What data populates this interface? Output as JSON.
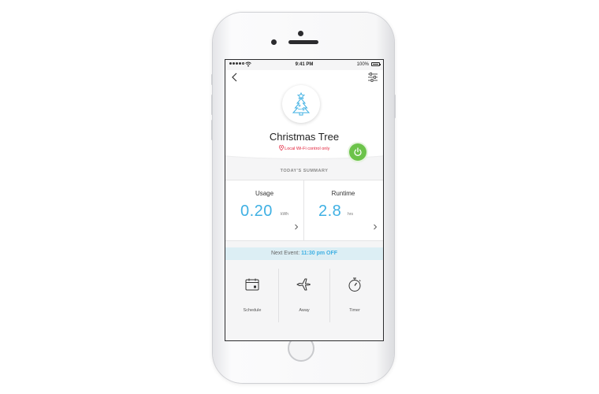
{
  "status_bar": {
    "time": "9:41 PM",
    "battery": "100%"
  },
  "nav": {
    "back_icon": "chevron-left-icon",
    "settings_icon": "sliders-icon"
  },
  "device": {
    "name": "Christmas Tree",
    "icon": "christmas-tree-icon",
    "note": "Local Wi-Fi control only",
    "power_on": true,
    "power_color": "#6cc34a"
  },
  "summary": {
    "title": "TODAY'S SUMMARY",
    "usage": {
      "label": "Usage",
      "value": "0.20",
      "unit": "kWh"
    },
    "runtime": {
      "label": "Runtime",
      "value": "2.8",
      "unit": "hrs"
    }
  },
  "next_event": {
    "prefix": "Next Event:",
    "time": "11:30 pm OFF"
  },
  "actions": [
    {
      "label": "Schedule",
      "icon": "calendar-icon"
    },
    {
      "label": "Away",
      "icon": "airplane-icon"
    },
    {
      "label": "Timer",
      "icon": "stopwatch-icon"
    }
  ],
  "colors": {
    "accent": "#3fb0e3",
    "warning": "#e2203a",
    "event_bg": "#dceef4"
  }
}
